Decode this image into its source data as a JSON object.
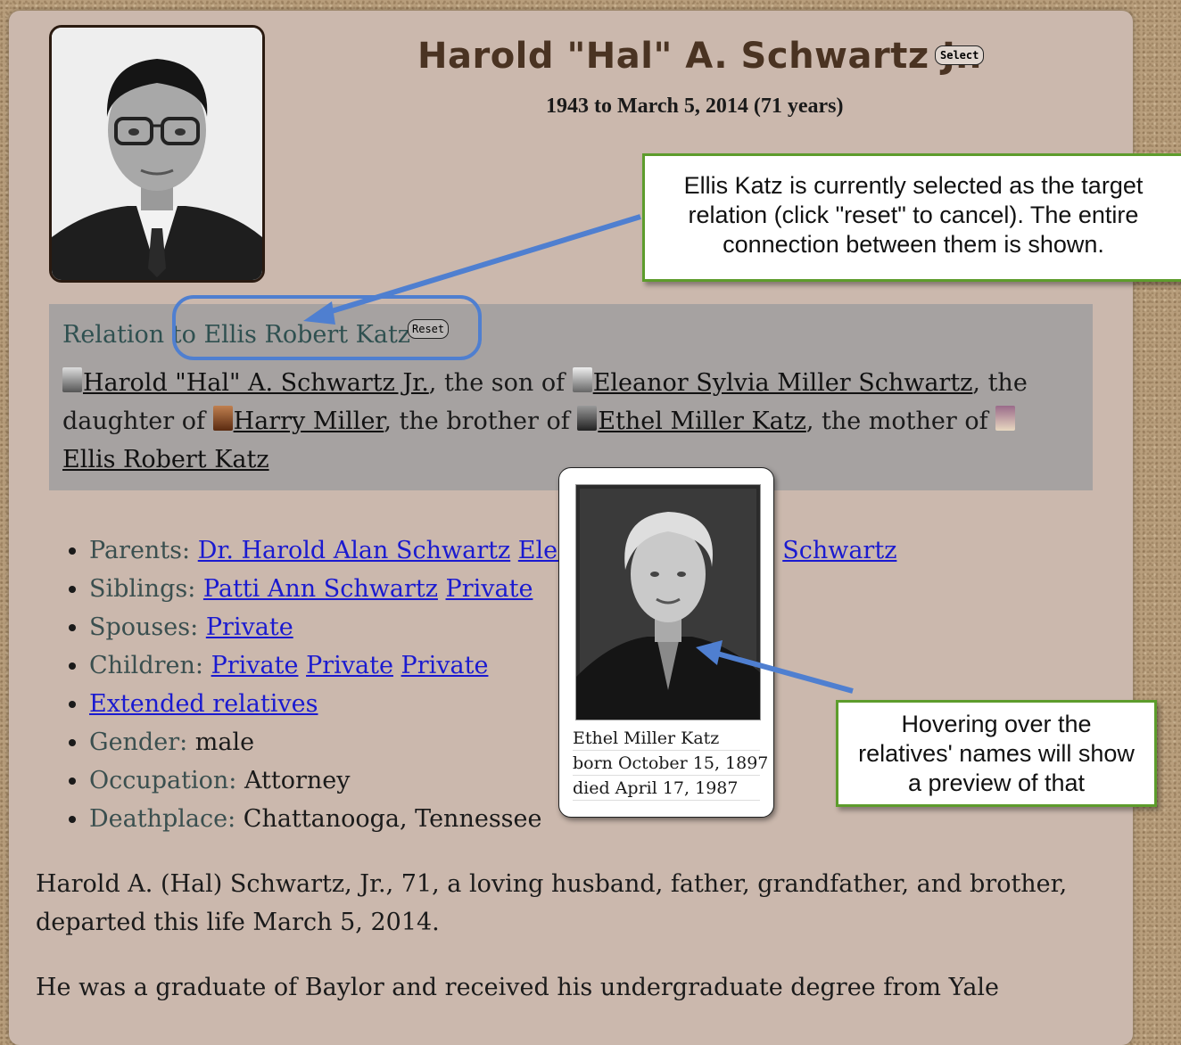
{
  "profile": {
    "name": "Harold \"Hal\" A. Schwartz Jr.",
    "select_label": "Select",
    "dates": "1943 to March 5, 2014 (71 years)"
  },
  "relation": {
    "title": "Relation to Ellis Robert Katz",
    "reset_label": "Reset",
    "chain": {
      "person1": "Harold \"Hal\" A. Schwartz Jr.",
      "text1": ", the son of ",
      "person2": "Eleanor Sylvia Miller Schwartz",
      "text2": ", the daughter of ",
      "person3": "Harry Miller",
      "text3": ", the brother of ",
      "person4": "Ethel Miller Katz",
      "text4": ", the mother of ",
      "person5": "Ellis Robert Katz"
    }
  },
  "facts": {
    "parents_label": "Parents:",
    "parent1": "Dr. Harold Alan Schwartz",
    "parent2_visible": "Elea",
    "parent2_tail": "Schwartz",
    "siblings_label": "Siblings:",
    "sibling1": "Patti Ann Schwartz",
    "sibling2": "Private",
    "spouses_label": "Spouses:",
    "spouse1": "Private",
    "children_label": "Children:",
    "child1": "Private",
    "child2": "Private",
    "child3": "Private",
    "extended": "Extended relatives",
    "gender_label": "Gender:",
    "gender": "male",
    "occupation_label": "Occupation:",
    "occupation": "Attorney",
    "deathplace_label": "Deathplace:",
    "deathplace": "Chattanooga, Tennessee"
  },
  "bio": {
    "para1": "Harold A. (Hal) Schwartz, Jr., 71, a loving husband, father, grandfather, and brother, departed this life March 5, 2014.",
    "para2": "He was a graduate of Baylor and received his undergraduate degree from Yale"
  },
  "preview": {
    "name": "Ethel Miller Katz",
    "born": "born October 15, 1897",
    "died": "died April 17, 1987"
  },
  "callouts": {
    "selected_note": "Ellis Katz is currently selected as the target relation (click \"reset\" to cancel).  The entire connection between them is shown.",
    "hover_note": "Hovering over the relatives' names will show a preview of that"
  },
  "colors": {
    "page_bg": "#b89e7c",
    "card_bg": "#cbb8ad",
    "relation_bg": "#a6a2a1",
    "link": "#1a1ad0",
    "label": "#3a4f4f",
    "callout_border": "#5d9c2c",
    "arrow": "#4f7fd0"
  }
}
